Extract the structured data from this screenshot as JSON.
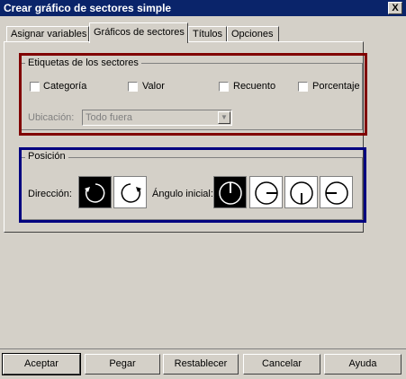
{
  "window": {
    "title": "Crear gráfico de sectores simple",
    "close_label": "X"
  },
  "tabs": [
    {
      "label": "Asignar variables"
    },
    {
      "label": "Gráficos de sectores"
    },
    {
      "label": "Títulos"
    },
    {
      "label": "Opciones"
    }
  ],
  "labels_group": {
    "legend": "Etiquetas de los sectores",
    "checkboxes": [
      {
        "label": "Categoría",
        "checked": false
      },
      {
        "label": "Valor",
        "checked": false
      },
      {
        "label": "Recuento",
        "checked": false
      },
      {
        "label": "Porcentaje",
        "checked": false
      }
    ],
    "location_label": "Ubicación:",
    "location_value": "Todo fuera"
  },
  "position_group": {
    "legend": "Posición",
    "direction_label": "Dirección:",
    "angle_label": "Ángulo inicial:",
    "direction_options": [
      {
        "icon": "clockwise-arrow-icon",
        "selected": true
      },
      {
        "icon": "counterclockwise-arrow-icon",
        "selected": false
      }
    ],
    "angle_options": [
      {
        "icon": "angle-12-oclock-icon",
        "selected": true
      },
      {
        "icon": "angle-3-oclock-icon",
        "selected": false
      },
      {
        "icon": "angle-6-oclock-icon",
        "selected": false
      },
      {
        "icon": "angle-9-oclock-icon",
        "selected": false
      }
    ]
  },
  "highlight_colors": {
    "labels_group": "#800000",
    "position_group": "#000080"
  },
  "buttons": {
    "accept": "Aceptar",
    "paste": "Pegar",
    "reset": "Restablecer",
    "cancel": "Cancelar",
    "help": "Ayuda"
  }
}
